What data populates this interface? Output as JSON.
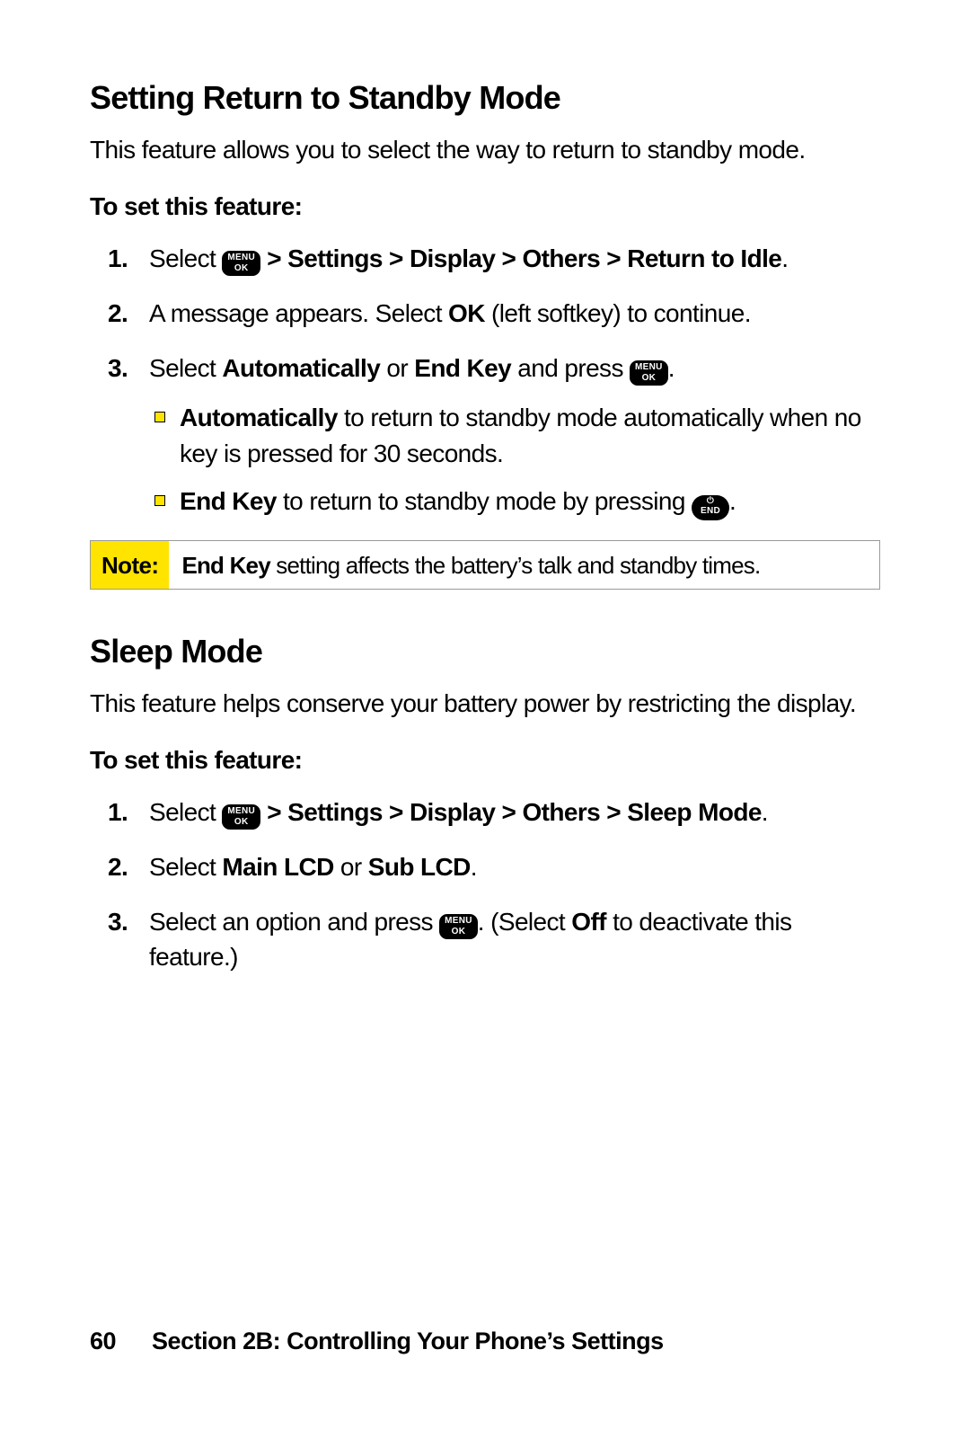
{
  "section1": {
    "title": "Setting Return to Standby Mode",
    "intro": "This feature allows you to select the way to return to standby mode.",
    "subhead": "To set this feature:",
    "step1_a": "Select ",
    "step1_b": " > Settings > Display > Others > Return to Idle",
    "step1_c": ".",
    "step2_a": "A message appears. Select ",
    "step2_b": "OK",
    "step2_c": " (left softkey) to continue.",
    "step3_a": "Select ",
    "step3_b": "Automatically",
    "step3_c": " or ",
    "step3_d": "End Key",
    "step3_e": " and press ",
    "step3_f": ".",
    "bullet1_a": "Automatically",
    "bullet1_b": " to return to standby mode automatically when no key is pressed for 30 seconds.",
    "bullet2_a": "End Key",
    "bullet2_b": " to return to standby mode by pressing ",
    "bullet2_c": "."
  },
  "note": {
    "label": "Note:",
    "body_a": "End Key",
    "body_b": " setting affects the battery’s talk and standby times."
  },
  "section2": {
    "title": "Sleep Mode",
    "intro": "This feature helps conserve your battery power by restricting the display.",
    "subhead": "To set this feature:",
    "step1_a": "Select ",
    "step1_b": " > Settings > Display > Others > Sleep Mode",
    "step1_c": ".",
    "step2_a": "Select ",
    "step2_b": "Main LCD",
    "step2_c": " or ",
    "step2_d": "Sub LCD",
    "step2_e": ".",
    "step3_a": "Select an option and press ",
    "step3_b": ". (Select ",
    "step3_c": "Off",
    "step3_d": " to deactivate this feature.)"
  },
  "footer": {
    "page_number": "60",
    "section_label": "Section 2B: Controlling Your Phone’s Settings"
  },
  "nums": {
    "n1": "1.",
    "n2": "2.",
    "n3": "3."
  }
}
